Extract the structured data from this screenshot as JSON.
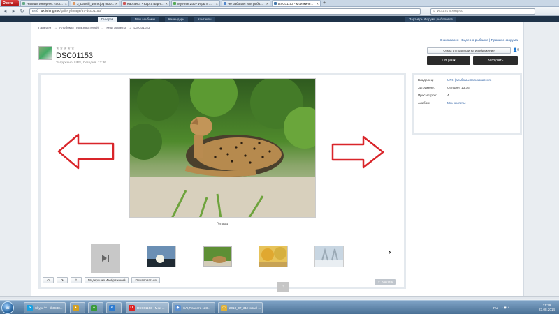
{
  "browser": {
    "menu_label": "Opera",
    "tabs": [
      {
        "title": "Напиши интернет: сост..."
      },
      {
        "title": "3_Dancill_10ms.jpg (800..."
      },
      {
        "title": "КартаИсГ • Карта Барн..."
      },
      {
        "title": "My Free Zoo - Игры в ..."
      },
      {
        "title": "Не работает или рабо..."
      },
      {
        "title": "DSC01153 - Мои жиле..."
      }
    ],
    "new_tab": "+",
    "back": "◂",
    "forward": "▸",
    "reload": "↻",
    "secure_label": "Веб",
    "url_host": "ukfishing.net",
    "url_path": "/gallery/image/37-dsc01153/",
    "search_placeholder": "Искать в Яндекс"
  },
  "site_nav": {
    "items": [
      "Галерея",
      "Мои альбомы",
      "Календарь",
      "Контакты",
      "Партнёры Форума рыболовов"
    ]
  },
  "breadcrumb": [
    "Галерея",
    "→",
    "Альбомы Пользователей",
    "→",
    "Мои жилеты",
    "→",
    "DSC01153"
  ],
  "header_links": "Знакомимся | Видео о рыбалке | Правила форума",
  "photo": {
    "rating_stars": "★★★★★",
    "title": "DSC01153",
    "uploaded": "Загружено: UPS, Сегодня, 13:36",
    "caption": "Гепард"
  },
  "actions": {
    "unsubscribe": "Отказ от подписки на изображение",
    "followers": "0",
    "options": "Опции ▾",
    "upload": "Загрузить"
  },
  "info": {
    "owner_label": "Владелец:",
    "owner_value": "UPS (альбомы пользователя)",
    "uploaded_label": "Загружено:",
    "uploaded_value": "Сегодня, 13:36",
    "views_label": "Просмотров:",
    "views_value": "4",
    "album_label": "Альбом:",
    "album_value": "Мои жилеты"
  },
  "tools": {
    "moderation": "Модерация Изображений",
    "share": "Пожаловаться",
    "complain": "✔ Удалить"
  },
  "next_icon": "›",
  "scroll_top": "↑",
  "taskbar": {
    "tasks": [
      {
        "label": "Skype™ - dk0948..."
      },
      {
        "label": ""
      },
      {
        "label": ""
      },
      {
        "label": ""
      },
      {
        "label": "DSC01153 - Мои ..."
      },
      {
        "label": "SAI,Планета 123..."
      },
      {
        "label": "2013_07_31 Новый ..."
      }
    ],
    "lang": "RU",
    "time": "21:39",
    "date": "23.08.2014"
  },
  "colors": {
    "accent_link": "#2a5ea3",
    "button_dark": "#2b2b2b",
    "arrow_red": "#d9252a"
  }
}
